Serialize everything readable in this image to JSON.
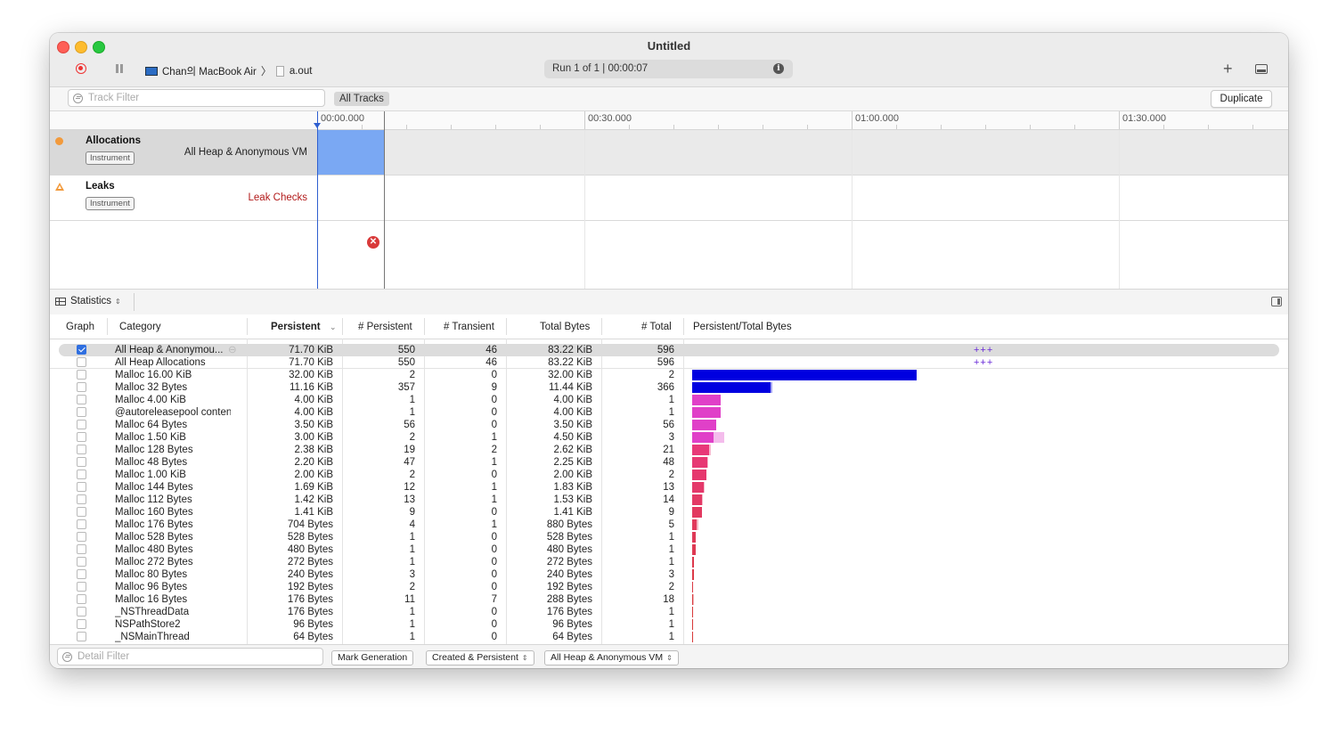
{
  "window": {
    "title": "Untitled",
    "device": "Chan의 MacBook Air",
    "target": "a.out",
    "run_status": "Run 1 of 1  |  00:00:07"
  },
  "filter_bar": {
    "track_filter_placeholder": "Track Filter",
    "all_tracks_label": "All Tracks",
    "duplicate_label": "Duplicate"
  },
  "ruler": {
    "ticks": [
      "00:00.000",
      "00:30.000",
      "01:00.000",
      "01:30.000"
    ]
  },
  "tracks": [
    {
      "name": "Allocations",
      "badge": "Instrument",
      "subtitle": "All Heap & Anonymous VM",
      "icon": "allocations-icon"
    },
    {
      "name": "Leaks",
      "badge": "Instrument",
      "subtitle": "Leak Checks",
      "icon": "leaks-icon"
    }
  ],
  "stats": {
    "mode_label": "Statistics",
    "columns": [
      "Graph",
      "Category",
      "Persistent",
      "# Persistent",
      "# Transient",
      "Total Bytes",
      "# Total",
      "Persistent/Total Bytes"
    ],
    "rows": [
      {
        "checked": true,
        "category": "All Heap & Anonymou...",
        "persistent": "71.70 KiB",
        "n_persistent": "550",
        "n_transient": "46",
        "total_bytes": "83.22 KiB",
        "n_total": "596",
        "marker": "+++",
        "bar_fraction": 0,
        "tail_fraction": 0
      },
      {
        "checked": false,
        "category": "All Heap Allocations",
        "persistent": "71.70 KiB",
        "n_persistent": "550",
        "n_transient": "46",
        "total_bytes": "83.22 KiB",
        "n_total": "596",
        "marker": "+++",
        "bar_fraction": 0,
        "tail_fraction": 0
      },
      {
        "checked": false,
        "category": "Malloc 16.00 KiB",
        "persistent": "32.00 KiB",
        "n_persistent": "2",
        "n_transient": "0",
        "total_bytes": "32.00 KiB",
        "n_total": "2",
        "marker": "",
        "bar_fraction": 1.0,
        "tail_fraction": 0
      },
      {
        "checked": false,
        "category": "Malloc 32 Bytes",
        "persistent": "11.16 KiB",
        "n_persistent": "357",
        "n_transient": "9",
        "total_bytes": "11.44 KiB",
        "n_total": "366",
        "marker": "",
        "bar_fraction": 0.349,
        "tail_fraction": 0.009
      },
      {
        "checked": false,
        "category": "Malloc 4.00 KiB",
        "persistent": "4.00 KiB",
        "n_persistent": "1",
        "n_transient": "0",
        "total_bytes": "4.00 KiB",
        "n_total": "1",
        "marker": "",
        "bar_fraction": 0.125,
        "tail_fraction": 0
      },
      {
        "checked": false,
        "category": "@autoreleasepool content",
        "persistent": "4.00 KiB",
        "n_persistent": "1",
        "n_transient": "0",
        "total_bytes": "4.00 KiB",
        "n_total": "1",
        "marker": "",
        "bar_fraction": 0.125,
        "tail_fraction": 0
      },
      {
        "checked": false,
        "category": "Malloc 64 Bytes",
        "persistent": "3.50 KiB",
        "n_persistent": "56",
        "n_transient": "0",
        "total_bytes": "3.50 KiB",
        "n_total": "56",
        "marker": "",
        "bar_fraction": 0.109,
        "tail_fraction": 0
      },
      {
        "checked": false,
        "category": "Malloc 1.50 KiB",
        "persistent": "3.00 KiB",
        "n_persistent": "2",
        "n_transient": "1",
        "total_bytes": "4.50 KiB",
        "n_total": "3",
        "marker": "",
        "bar_fraction": 0.094,
        "tail_fraction": 0.047
      },
      {
        "checked": false,
        "category": "Malloc 128 Bytes",
        "persistent": "2.38 KiB",
        "n_persistent": "19",
        "n_transient": "2",
        "total_bytes": "2.62 KiB",
        "n_total": "21",
        "marker": "",
        "bar_fraction": 0.074,
        "tail_fraction": 0.008
      },
      {
        "checked": false,
        "category": "Malloc 48 Bytes",
        "persistent": "2.20 KiB",
        "n_persistent": "47",
        "n_transient": "1",
        "total_bytes": "2.25 KiB",
        "n_total": "48",
        "marker": "",
        "bar_fraction": 0.069,
        "tail_fraction": 0.002
      },
      {
        "checked": false,
        "category": "Malloc 1.00 KiB",
        "persistent": "2.00 KiB",
        "n_persistent": "2",
        "n_transient": "0",
        "total_bytes": "2.00 KiB",
        "n_total": "2",
        "marker": "",
        "bar_fraction": 0.0625,
        "tail_fraction": 0
      },
      {
        "checked": false,
        "category": "Malloc 144 Bytes",
        "persistent": "1.69 KiB",
        "n_persistent": "12",
        "n_transient": "1",
        "total_bytes": "1.83 KiB",
        "n_total": "13",
        "marker": "",
        "bar_fraction": 0.053,
        "tail_fraction": 0.004
      },
      {
        "checked": false,
        "category": "Malloc 112 Bytes",
        "persistent": "1.42 KiB",
        "n_persistent": "13",
        "n_transient": "1",
        "total_bytes": "1.53 KiB",
        "n_total": "14",
        "marker": "",
        "bar_fraction": 0.044,
        "tail_fraction": 0.003
      },
      {
        "checked": false,
        "category": "Malloc 160 Bytes",
        "persistent": "1.41 KiB",
        "n_persistent": "9",
        "n_transient": "0",
        "total_bytes": "1.41 KiB",
        "n_total": "9",
        "marker": "",
        "bar_fraction": 0.044,
        "tail_fraction": 0
      },
      {
        "checked": false,
        "category": "Malloc 176 Bytes",
        "persistent": "704 Bytes",
        "n_persistent": "4",
        "n_transient": "1",
        "total_bytes": "880 Bytes",
        "n_total": "5",
        "marker": "",
        "bar_fraction": 0.0215,
        "tail_fraction": 0.005
      },
      {
        "checked": false,
        "category": "Malloc 528 Bytes",
        "persistent": "528 Bytes",
        "n_persistent": "1",
        "n_transient": "0",
        "total_bytes": "528 Bytes",
        "n_total": "1",
        "marker": "",
        "bar_fraction": 0.016,
        "tail_fraction": 0
      },
      {
        "checked": false,
        "category": "Malloc 480 Bytes",
        "persistent": "480 Bytes",
        "n_persistent": "1",
        "n_transient": "0",
        "total_bytes": "480 Bytes",
        "n_total": "1",
        "marker": "",
        "bar_fraction": 0.0147,
        "tail_fraction": 0
      },
      {
        "checked": false,
        "category": "Malloc 272 Bytes",
        "persistent": "272 Bytes",
        "n_persistent": "1",
        "n_transient": "0",
        "total_bytes": "272 Bytes",
        "n_total": "1",
        "marker": "",
        "bar_fraction": 0.0083,
        "tail_fraction": 0
      },
      {
        "checked": false,
        "category": "Malloc 80 Bytes",
        "persistent": "240 Bytes",
        "n_persistent": "3",
        "n_transient": "0",
        "total_bytes": "240 Bytes",
        "n_total": "3",
        "marker": "",
        "bar_fraction": 0.0073,
        "tail_fraction": 0
      },
      {
        "checked": false,
        "category": "Malloc 96 Bytes",
        "persistent": "192 Bytes",
        "n_persistent": "2",
        "n_transient": "0",
        "total_bytes": "192 Bytes",
        "n_total": "2",
        "marker": "",
        "bar_fraction": 0.0059,
        "tail_fraction": 0
      },
      {
        "checked": false,
        "category": "Malloc 16 Bytes",
        "persistent": "176 Bytes",
        "n_persistent": "11",
        "n_transient": "7",
        "total_bytes": "288 Bytes",
        "n_total": "18",
        "marker": "",
        "bar_fraction": 0.0054,
        "tail_fraction": 0.0034
      },
      {
        "checked": false,
        "category": "_NSThreadData",
        "persistent": "176 Bytes",
        "n_persistent": "1",
        "n_transient": "0",
        "total_bytes": "176 Bytes",
        "n_total": "1",
        "marker": "",
        "bar_fraction": 0.0054,
        "tail_fraction": 0
      },
      {
        "checked": false,
        "category": "NSPathStore2",
        "persistent": "96 Bytes",
        "n_persistent": "1",
        "n_transient": "0",
        "total_bytes": "96 Bytes",
        "n_total": "1",
        "marker": "",
        "bar_fraction": 0.003,
        "tail_fraction": 0
      },
      {
        "checked": false,
        "category": "_NSMainThread",
        "persistent": "64 Bytes",
        "n_persistent": "1",
        "n_transient": "0",
        "total_bytes": "64 Bytes",
        "n_total": "1",
        "marker": "",
        "bar_fraction": 0.002,
        "tail_fraction": 0
      }
    ]
  },
  "bottom_bar": {
    "detail_filter_placeholder": "Detail Filter",
    "mark_generation_label": "Mark Generation",
    "created_persistent_label": "Created & Persistent",
    "heap_scope_label": "All Heap & Anonymous VM"
  },
  "colors": {
    "accent": "#2f6fe0",
    "selection_block": "#7aa8f3",
    "bar_top": "#0000e0",
    "bar_pink": "#e040c8",
    "bar_red": "#d83a3a"
  }
}
